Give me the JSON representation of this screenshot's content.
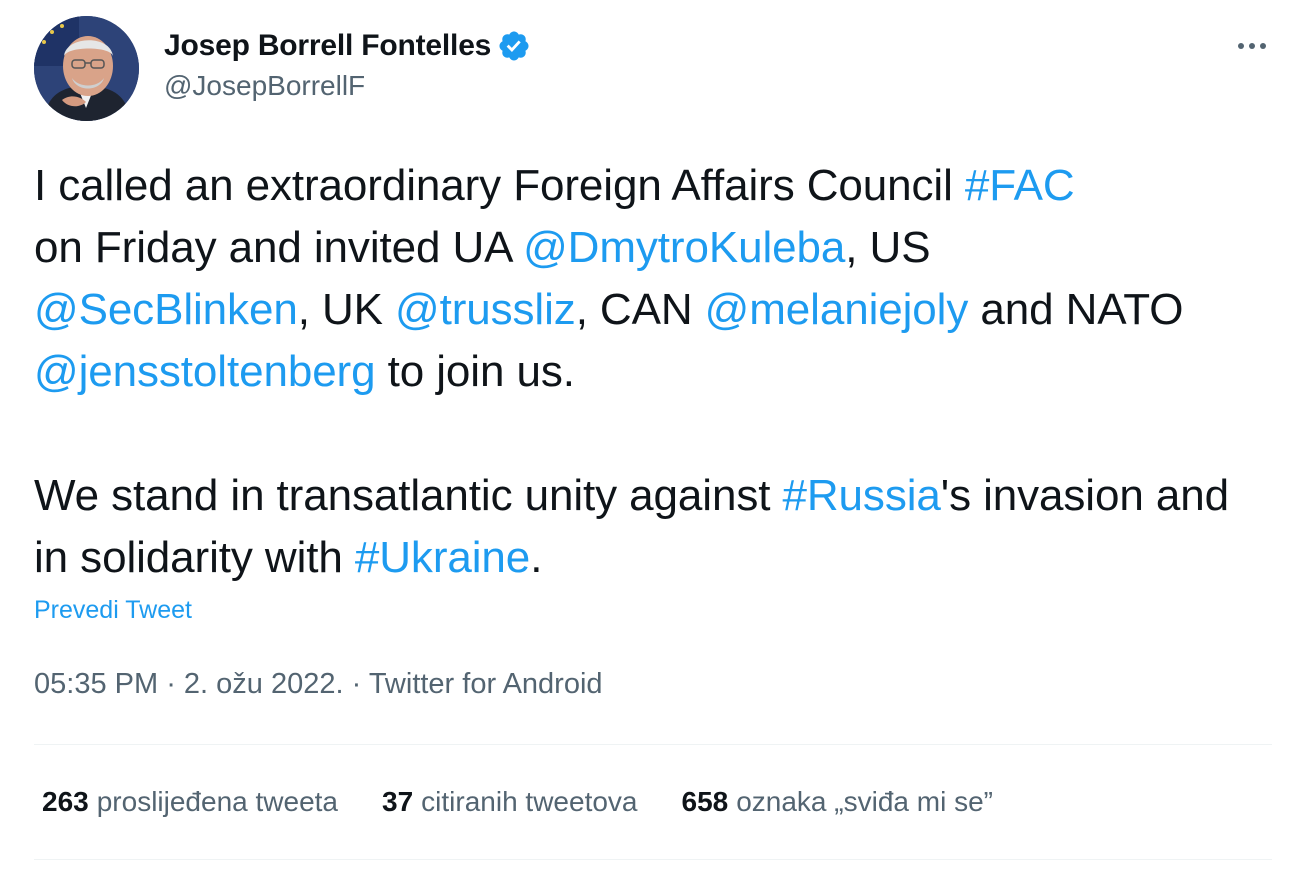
{
  "author": {
    "display_name": "Josep Borrell Fontelles",
    "handle": "@JosepBorrellF"
  },
  "tweet": {
    "p1": {
      "t1": "I called an extraordinary Foreign Affairs Council ",
      "hashtag_fac": "#FAC",
      "t2": " on Friday and invited UA ",
      "mention_kuleba": "@DmytroKuleba",
      "t3": ", US ",
      "mention_blinken": "@SecBlinken",
      "t4": ", UK ",
      "mention_truss": "@trussliz",
      "t5": ", CAN ",
      "mention_joly": "@melaniejoly",
      "t6": " and NATO ",
      "mention_stoltenberg": "@jensstoltenberg",
      "t7": " to join us."
    },
    "p2": {
      "t1": "We stand in transatlantic unity against ",
      "hashtag_russia": "#Russia",
      "t2": "'s invasion and in solidarity with ",
      "hashtag_ukraine": "#Ukraine",
      "t3": "."
    }
  },
  "translate_label": "Prevedi Tweet",
  "meta": {
    "time": "05:35 PM",
    "separator": " · ",
    "date": "2. ožu 2022.",
    "source": "Twitter for Android"
  },
  "stats": {
    "retweets": {
      "count": "263",
      "label": "proslijeđena tweeta"
    },
    "quotes": {
      "count": "37",
      "label": "citiranih tweetova"
    },
    "likes": {
      "count": "658",
      "label": "oznaka „sviđa mi se”"
    }
  },
  "colors": {
    "link": "#1d9bf0",
    "text": "#0f1419",
    "secondary": "#536471",
    "divider": "#eff3f4"
  },
  "icons": {
    "verified": "verified-badge-icon",
    "more": "more-dots-icon"
  }
}
